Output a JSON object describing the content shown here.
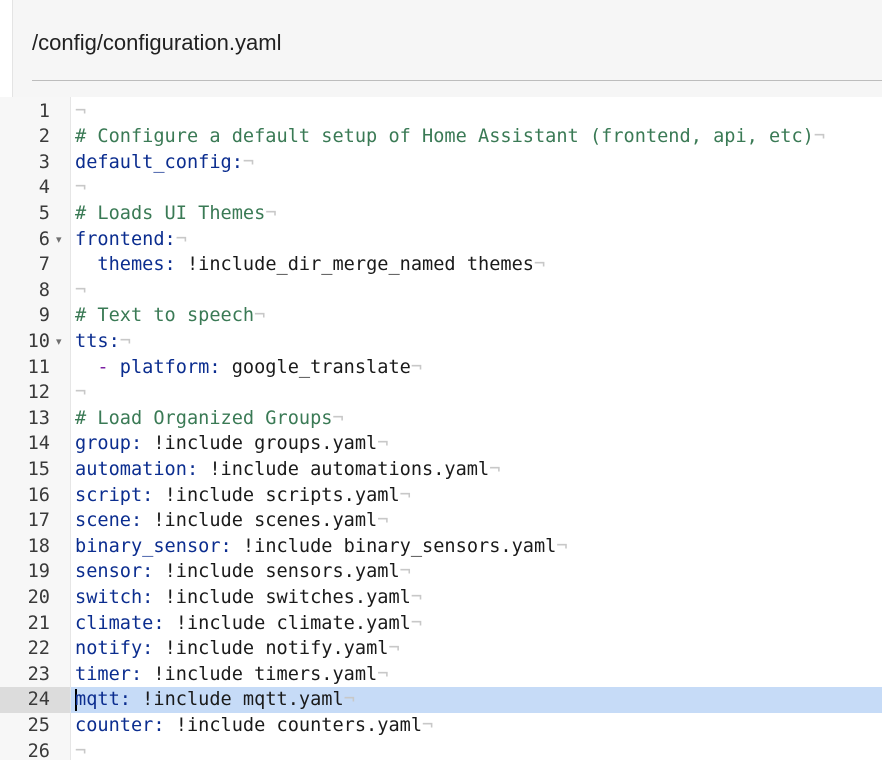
{
  "header": {
    "file_path": "/config/configuration.yaml"
  },
  "editor": {
    "active_line": 24,
    "lines": [
      {
        "n": "1",
        "fold": false,
        "tokens": []
      },
      {
        "n": "2",
        "fold": false,
        "tokens": [
          {
            "t": "c",
            "s": "# Configure a default setup of Home Assistant (frontend, api, etc)"
          }
        ]
      },
      {
        "n": "3",
        "fold": false,
        "tokens": [
          {
            "t": "k",
            "s": "default_config:"
          }
        ]
      },
      {
        "n": "4",
        "fold": false,
        "tokens": []
      },
      {
        "n": "5",
        "fold": false,
        "tokens": [
          {
            "t": "c",
            "s": "# Loads UI Themes"
          }
        ]
      },
      {
        "n": "6",
        "fold": true,
        "tokens": [
          {
            "t": "k",
            "s": "frontend:"
          }
        ]
      },
      {
        "n": "7",
        "fold": false,
        "tokens": [
          {
            "t": "ws",
            "s": "  "
          },
          {
            "t": "k",
            "s": "themes:"
          },
          {
            "t": "v",
            "s": " !include_dir_merge_named themes"
          }
        ]
      },
      {
        "n": "8",
        "fold": false,
        "tokens": []
      },
      {
        "n": "9",
        "fold": false,
        "tokens": [
          {
            "t": "c",
            "s": "# Text to speech"
          }
        ]
      },
      {
        "n": "10",
        "fold": true,
        "tokens": [
          {
            "t": "k",
            "s": "tts:"
          }
        ]
      },
      {
        "n": "11",
        "fold": false,
        "tokens": [
          {
            "t": "ws",
            "s": "  "
          },
          {
            "t": "dash",
            "s": "- "
          },
          {
            "t": "k",
            "s": "platform:"
          },
          {
            "t": "v",
            "s": " google_translate"
          }
        ]
      },
      {
        "n": "12",
        "fold": false,
        "tokens": []
      },
      {
        "n": "13",
        "fold": false,
        "tokens": [
          {
            "t": "c",
            "s": "# Load Organized Groups"
          }
        ]
      },
      {
        "n": "14",
        "fold": false,
        "tokens": [
          {
            "t": "k",
            "s": "group:"
          },
          {
            "t": "v",
            "s": " !include groups.yaml"
          }
        ]
      },
      {
        "n": "15",
        "fold": false,
        "tokens": [
          {
            "t": "k",
            "s": "automation:"
          },
          {
            "t": "v",
            "s": " !include automations.yaml"
          }
        ]
      },
      {
        "n": "16",
        "fold": false,
        "tokens": [
          {
            "t": "k",
            "s": "script:"
          },
          {
            "t": "v",
            "s": " !include scripts.yaml"
          }
        ]
      },
      {
        "n": "17",
        "fold": false,
        "tokens": [
          {
            "t": "k",
            "s": "scene:"
          },
          {
            "t": "v",
            "s": " !include scenes.yaml"
          }
        ]
      },
      {
        "n": "18",
        "fold": false,
        "tokens": [
          {
            "t": "k",
            "s": "binary_sensor:"
          },
          {
            "t": "v",
            "s": " !include binary_sensors.yaml"
          }
        ]
      },
      {
        "n": "19",
        "fold": false,
        "tokens": [
          {
            "t": "k",
            "s": "sensor:"
          },
          {
            "t": "v",
            "s": " !include sensors.yaml"
          }
        ]
      },
      {
        "n": "20",
        "fold": false,
        "tokens": [
          {
            "t": "k",
            "s": "switch:"
          },
          {
            "t": "v",
            "s": " !include switches.yaml"
          }
        ]
      },
      {
        "n": "21",
        "fold": false,
        "tokens": [
          {
            "t": "k",
            "s": "climate:"
          },
          {
            "t": "v",
            "s": " !include climate.yaml"
          }
        ]
      },
      {
        "n": "22",
        "fold": false,
        "tokens": [
          {
            "t": "k",
            "s": "notify:"
          },
          {
            "t": "v",
            "s": " !include notify.yaml"
          }
        ]
      },
      {
        "n": "23",
        "fold": false,
        "tokens": [
          {
            "t": "k",
            "s": "timer:"
          },
          {
            "t": "v",
            "s": " !include timers.yaml"
          }
        ]
      },
      {
        "n": "24",
        "fold": false,
        "tokens": [
          {
            "t": "k",
            "s": "mqtt:"
          },
          {
            "t": "v",
            "s": " !include mqtt.yaml"
          }
        ]
      },
      {
        "n": "25",
        "fold": false,
        "tokens": [
          {
            "t": "k",
            "s": "counter:"
          },
          {
            "t": "v",
            "s": " !include counters.yaml"
          }
        ]
      },
      {
        "n": "26",
        "fold": false,
        "tokens": []
      }
    ]
  },
  "colors": {
    "key": "#0b2d8f",
    "comment": "#3a7a55",
    "value": "#1a1a1a",
    "active_line_bg": "#c6dbf7",
    "invisible_char": "#c8c8c8"
  },
  "icons": {
    "fold": "fold-arrow-icon",
    "eol": "pilcrow-eol-icon"
  }
}
